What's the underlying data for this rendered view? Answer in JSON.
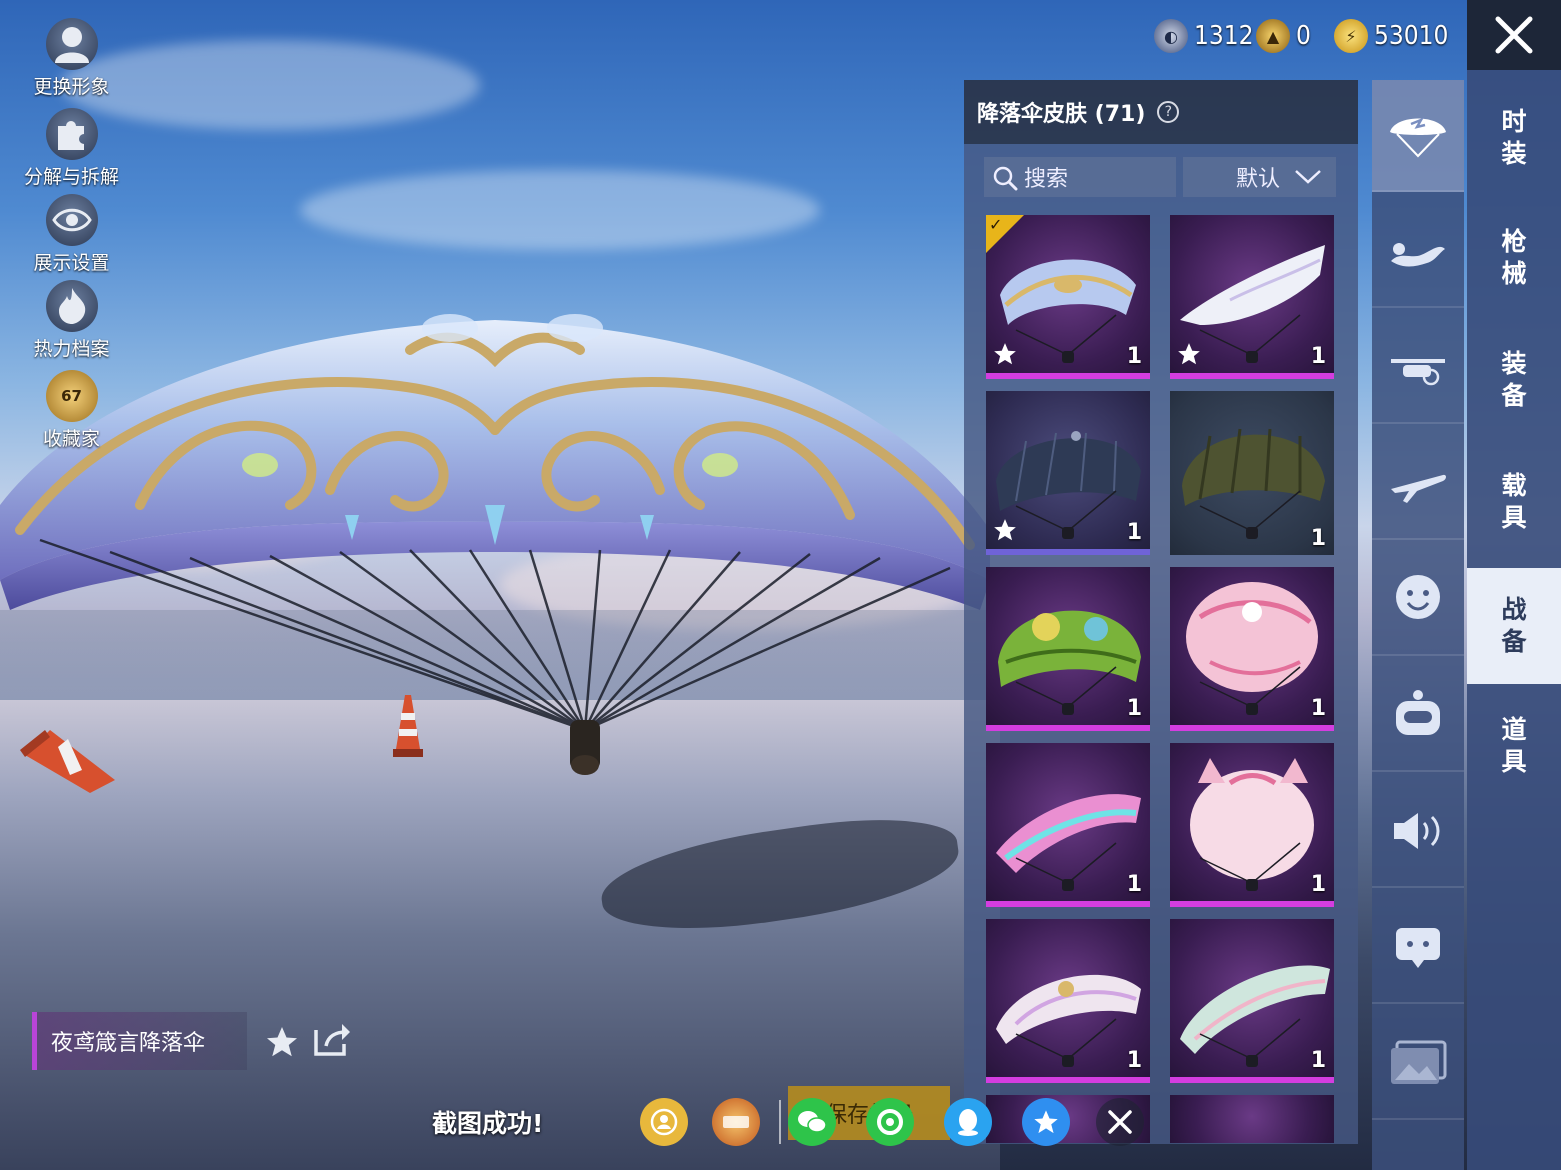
{
  "currency": {
    "coupons": "1312",
    "gold": "0",
    "bp": "53010"
  },
  "left_menu": [
    {
      "label": "更换形象",
      "icon": "avatar-icon"
    },
    {
      "label": "分解与拆解",
      "icon": "puzzle-icon"
    },
    {
      "label": "展示设置",
      "icon": "eye-icon"
    },
    {
      "label": "热力档案",
      "icon": "flame-icon"
    },
    {
      "label": "收藏家",
      "icon": "collector-badge-icon",
      "badge": "67"
    }
  ],
  "panel": {
    "title": "降落伞皮肤 (71)",
    "help": "?",
    "search_label": "搜索",
    "sort_label": "默认"
  },
  "items": [
    {
      "count": "1",
      "rarity": "purple",
      "starred": true,
      "equipped": true,
      "art": "ornate-gold-blue"
    },
    {
      "count": "1",
      "rarity": "purple",
      "starred": true,
      "equipped": false,
      "art": "white-wing"
    },
    {
      "count": "1",
      "rarity": "blue",
      "starred": true,
      "equipped": false,
      "art": "dark-navy"
    },
    {
      "count": "1",
      "rarity": "grey",
      "starred": false,
      "equipped": false,
      "art": "olive"
    },
    {
      "count": "1",
      "rarity": "purple",
      "starred": false,
      "equipped": false,
      "art": "green-cartoon"
    },
    {
      "count": "1",
      "rarity": "purple",
      "starred": false,
      "equipped": false,
      "art": "pink-round"
    },
    {
      "count": "1",
      "rarity": "purple",
      "starred": false,
      "equipped": false,
      "art": "pink-cyan"
    },
    {
      "count": "1",
      "rarity": "purple",
      "starred": false,
      "equipped": false,
      "art": "pink-cat"
    },
    {
      "count": "1",
      "rarity": "purple",
      "starred": false,
      "equipped": false,
      "art": "pink-white-ornate"
    },
    {
      "count": "1",
      "rarity": "purple",
      "starred": false,
      "equipped": false,
      "art": "pastel-leaf"
    }
  ],
  "icon_tabs": [
    "parachute-icon",
    "skydive-icon",
    "drone-icon",
    "plane-icon",
    "emote-icon",
    "robot-icon",
    "sound-icon",
    "chat-icon",
    "gallery-icon"
  ],
  "categories": [
    {
      "label": "时装"
    },
    {
      "label": "枪械"
    },
    {
      "label": "装备"
    },
    {
      "label": "载具"
    },
    {
      "label": "战备",
      "active": true
    },
    {
      "label": "道具"
    }
  ],
  "selected_item": {
    "name": "夜鸢箴言降落伞"
  },
  "screenshot_bar": {
    "toast": "截图成功!",
    "save_label": "保存相册",
    "shares": [
      "profile-share-icon",
      "game-app-icon",
      "wechat-icon",
      "moments-icon",
      "qq-icon",
      "qzone-icon",
      "close-icon"
    ]
  },
  "colors": {
    "accent_purple": "#d43de0",
    "gold": "#e8b51a",
    "panel_bg": "#465882"
  }
}
